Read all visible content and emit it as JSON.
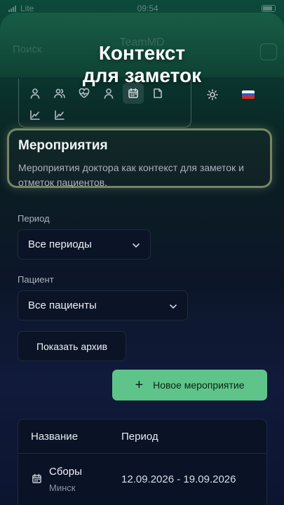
{
  "status_bar": {
    "carrier": "Lite",
    "time": "09:54"
  },
  "app_header": {
    "left_label": "Поиск",
    "app_name": "TeamMD"
  },
  "overlay": {
    "title_line1": "Контекст",
    "title_line2": "для заметок"
  },
  "nav_icons": [
    "user-icon",
    "users-icon",
    "heart-pulse-icon",
    "user-group-icon",
    "calendar-icon",
    "document-icon",
    "chart-line-icon",
    "chart-line-icon"
  ],
  "active_nav_icon": "calendar-icon",
  "toolbar_icons": [
    "sun-icon",
    "russian-flag-icon"
  ],
  "flag_colors": [
    "#ffffff",
    "#2a5fc9",
    "#d52b1e"
  ],
  "page": {
    "title": "Мероприятия",
    "description": "Мероприятия доктора как контекст для заметок и отметок пациентов."
  },
  "filters": {
    "period": {
      "label": "Период",
      "value": "Все периоды"
    },
    "patient": {
      "label": "Пациент",
      "value": "Все пациенты"
    }
  },
  "buttons": {
    "archive": "Показать архив",
    "new_event": "Новое мероприятие",
    "new_event_icon": "+"
  },
  "table": {
    "headers": [
      "Название",
      "Период"
    ],
    "rows": [
      {
        "icon": "calendar-icon",
        "name": "Сборы",
        "location": "Минск",
        "period": "12.09.2026 - 19.09.2026"
      }
    ]
  },
  "colors": {
    "accent": "#5fc48a",
    "highlight_border": "#c8d796",
    "surface": "#0b1326"
  }
}
